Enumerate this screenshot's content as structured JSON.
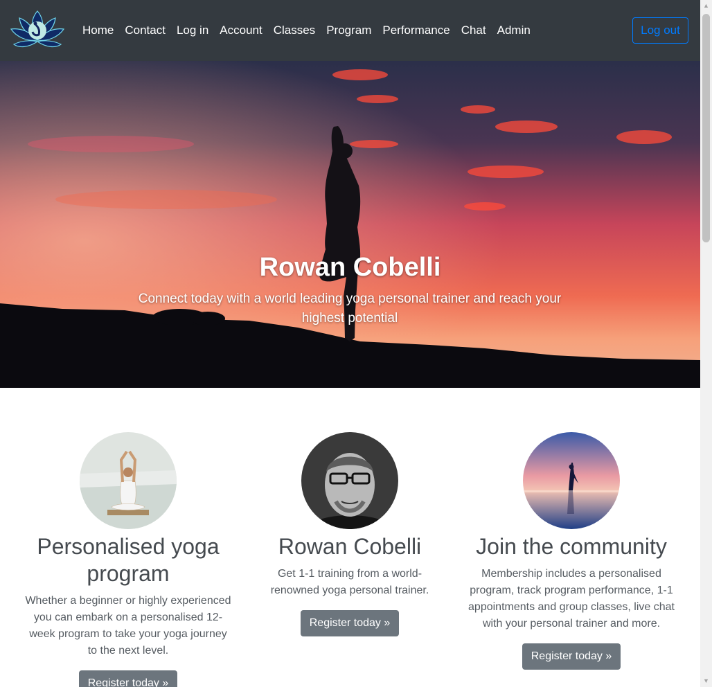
{
  "nav": {
    "links": [
      "Home",
      "Contact",
      "Log in",
      "Account",
      "Classes",
      "Program",
      "Performance",
      "Chat",
      "Admin"
    ],
    "logout_label": "Log out"
  },
  "hero": {
    "title": "Rowan Cobelli",
    "subtitle": "Connect today with a world leading yoga personal trainer and reach your highest potential"
  },
  "features": [
    {
      "title": "Personalised yoga program",
      "text": "Whether a beginner or highly experienced you can embark on a personalised 12-week program to take your yoga journey to the next level.",
      "button": "Register today »"
    },
    {
      "title": "Rowan Cobelli",
      "text": "Get 1-1 training from a world-renowned yoga personal trainer.",
      "button": "Register today »"
    },
    {
      "title": "Join the community",
      "text": "Membership includes a personalised program, track program performance, 1-1 appointments and group classes, live chat with your personal trainer and more.",
      "button": "Register today »"
    }
  ],
  "colors": {
    "navbar_bg": "#343a40",
    "outline_primary": "#007bff",
    "button_secondary": "#6c757d",
    "heading_text": "#454a4f"
  }
}
